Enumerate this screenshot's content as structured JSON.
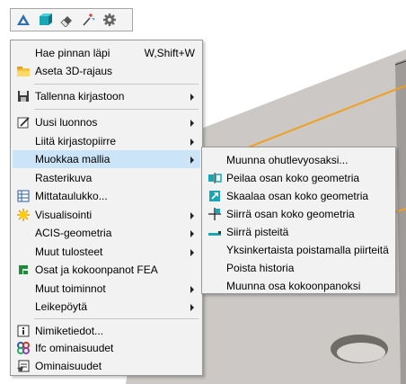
{
  "toolbar": {
    "buttons": [
      {
        "icon": "blue-triangle-icon"
      },
      {
        "icon": "teal-box-icon"
      },
      {
        "icon": "eraser-icon"
      },
      {
        "icon": "magic-wand-icon"
      },
      {
        "icon": "gear-icon"
      }
    ]
  },
  "context_menu": {
    "items": [
      {
        "label": "Hae pinnan läpi",
        "shortcut": "W,Shift+W",
        "icon": "",
        "submenu": false
      },
      {
        "label": "Aseta 3D-rajaus",
        "icon": "folder-icon",
        "submenu": false
      },
      {
        "label": "Tallenna kirjastoon",
        "icon": "save-icon",
        "submenu": true
      },
      {
        "label": "Uusi luonnos",
        "icon": "pencil-icon",
        "submenu": true
      },
      {
        "label": "Liitä kirjastopiirre",
        "icon": "",
        "submenu": true
      },
      {
        "label": "Muokkaa mallia",
        "icon": "",
        "submenu": true,
        "highlighted": true
      },
      {
        "label": "Rasterikuva",
        "icon": "",
        "submenu": false
      },
      {
        "label": "Mittataulukko...",
        "icon": "table-icon",
        "submenu": false
      },
      {
        "label": "Visualisointi",
        "icon": "sun-icon",
        "submenu": true
      },
      {
        "label": "ACIS-geometria",
        "icon": "",
        "submenu": true
      },
      {
        "label": "Muut tulosteet",
        "icon": "",
        "submenu": true
      },
      {
        "label": "Osat ja kokoonpanot FEA",
        "icon": "fea-icon",
        "submenu": false
      },
      {
        "label": "Muut toiminnot",
        "icon": "",
        "submenu": true
      },
      {
        "label": "Leikepöytä",
        "icon": "",
        "submenu": true
      },
      {
        "label": "Nimiketiedot...",
        "icon": "info-icon",
        "submenu": false
      },
      {
        "label": "Ifc ominaisuudet",
        "icon": "ifc-icon",
        "submenu": false
      },
      {
        "label": "Ominaisuudet",
        "icon": "properties-icon",
        "submenu": false
      }
    ]
  },
  "submenu": {
    "items": [
      {
        "label": "Muunna ohutlevyosaksi...",
        "icon": ""
      },
      {
        "label": "Peilaa osan koko geometria",
        "icon": "mirror-icon"
      },
      {
        "label": "Skaalaa osan koko geometria",
        "icon": "scale-icon"
      },
      {
        "label": "Siirrä osan koko geometria",
        "icon": "move-icon"
      },
      {
        "label": "Siirrä pisteitä",
        "icon": "points-icon"
      },
      {
        "label": "Yksinkertaista poistamalla piirteitä",
        "icon": ""
      },
      {
        "label": "Poista historia",
        "icon": ""
      },
      {
        "label": "Muunna osa kokoonpanoksi",
        "icon": ""
      }
    ]
  },
  "colors": {
    "highlight": "#cce4f7",
    "plate": "#c8c5c2",
    "edge_orange": "#f0a020"
  }
}
